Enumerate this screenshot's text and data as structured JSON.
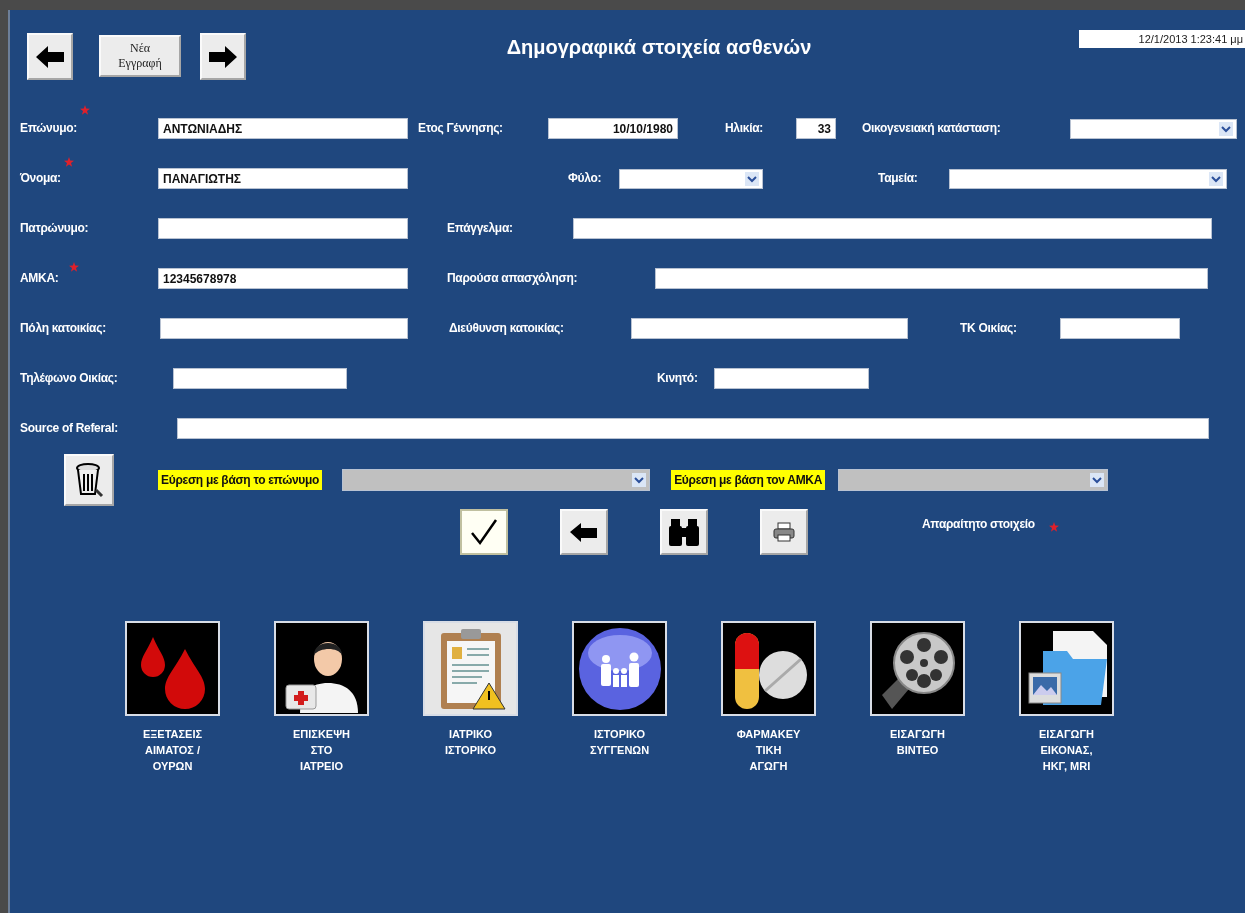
{
  "header": {
    "new_record_button": "Νέα\nΕγγραφή",
    "title": "Δημογραφικά στοιχεία ασθενών",
    "datetime": "12/1/2013 1:23:41 μμ"
  },
  "rows": [
    {
      "fields": [
        {
          "label": "Επώνυμο:",
          "required": true,
          "kind": "text",
          "value": "ΑΝΤΩΝΙΑΔΗΣ"
        },
        {
          "label": "Ετος Γέννησης:",
          "required": false,
          "kind": "text",
          "value": "10/10/1980"
        },
        {
          "label": "Ηλικία:",
          "required": false,
          "kind": "text",
          "value": "33"
        },
        {
          "label": "Οικογενειακή κατάσταση:",
          "required": false,
          "kind": "select"
        }
      ]
    },
    {
      "fields": [
        {
          "label": "Όνομα:",
          "required": true,
          "kind": "text",
          "value": "ΠΑΝΑΓΙΩΤΗΣ"
        },
        {
          "label": "Φύλο:",
          "required": false,
          "kind": "select"
        },
        {
          "label": "Ταμεία:",
          "required": false,
          "kind": "select"
        }
      ]
    },
    {
      "fields": [
        {
          "label": "Πατρώνυμο:",
          "required": false,
          "kind": "text"
        },
        {
          "label": "Επάγγελμα:",
          "required": false,
          "kind": "text"
        }
      ]
    },
    {
      "fields": [
        {
          "label": "ΑΜΚΑ:",
          "required": true,
          "kind": "text",
          "value": "12345678978"
        },
        {
          "label": "Παρούσα απασχόληση:",
          "required": false,
          "kind": "text"
        }
      ]
    },
    {
      "fields": [
        {
          "label": "Πόλη κατοικίας:",
          "required": false,
          "kind": "text"
        },
        {
          "label": "Διεύθυνση κατοικίας:",
          "required": false,
          "kind": "text"
        },
        {
          "label": "ΤΚ Οικίας:",
          "required": false,
          "kind": "text"
        }
      ]
    },
    {
      "fields": [
        {
          "label": "Τηλέφωνο Οικίας:",
          "required": false,
          "kind": "text"
        },
        {
          "label": "Κινητό:",
          "required": false,
          "kind": "text"
        }
      ]
    },
    {
      "fields": [
        {
          "label": "Source of Referal:",
          "required": false,
          "kind": "text"
        }
      ]
    }
  ],
  "search": [
    {
      "label": "Εύρεση με βάση το επώνυμο"
    },
    {
      "label": "Εύρεση με βάση τον ΑΜΚΑ"
    }
  ],
  "required_legend": "Απαραίτητο στοιχείο",
  "modules": [
    {
      "kind": "blood",
      "label": "ΕΞΕΤΑΣΕΙΣ\nΑΙΜΑΤΟΣ /\nΟΥΡΩΝ"
    },
    {
      "kind": "doctor",
      "label": "ΕΠΙΣΚΕΨΗ\nΣΤΟ\nΙΑΤΡΕΙΟ"
    },
    {
      "kind": "clipboard",
      "label": "ΙΑΤΡΙΚΟ\nΙΣΤΟΡΙΚΟ"
    },
    {
      "kind": "family",
      "label": "ΙΣΤΟΡΙΚΟ\nΣΥΓΓΕΝΩΝ"
    },
    {
      "kind": "pills",
      "label": "ΦΑΡΜΑΚΕΥ\nΤΙΚΗ\nΑΓΩΓΗ"
    },
    {
      "kind": "film",
      "label": "ΕΙΣΑΓΩΓΗ\nΒΙΝΤΕΟ"
    },
    {
      "kind": "images",
      "label": "ΕΙΣΑΓΩΓΗ\nΕΙΚΟΝΑΣ,\nΗΚΓ, MRI"
    }
  ]
}
